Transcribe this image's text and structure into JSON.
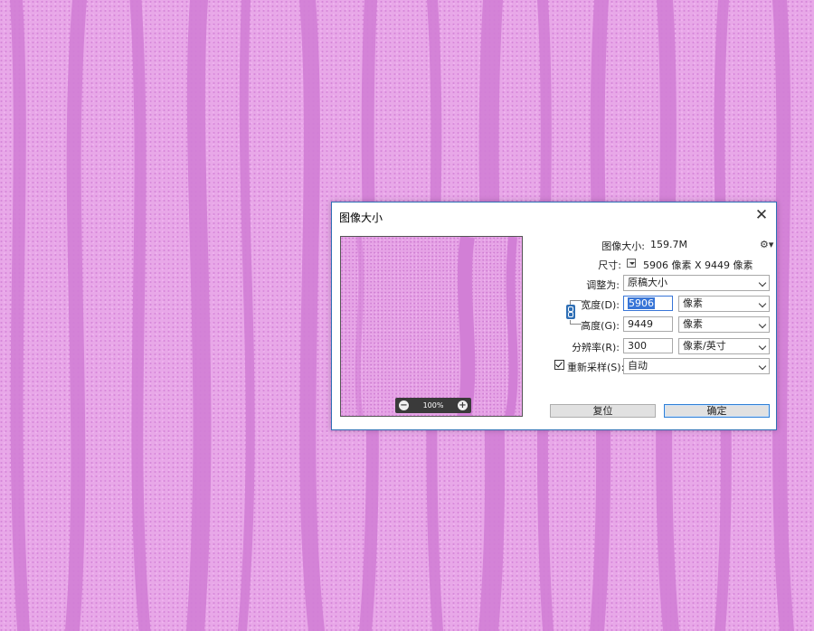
{
  "dialog": {
    "title": "图像大小",
    "close_glyph": "✕",
    "image_size_label": "图像大小:",
    "image_size_value": "159.7M",
    "dimensions_label": "尺寸:",
    "dimensions_value": "5906 像素  X  9449 像素",
    "fit_to_label": "调整为:",
    "fit_to_value": "原稿大小",
    "width_label": "宽度(D):",
    "width_value": "5906",
    "width_unit": "像素",
    "height_label": "高度(G):",
    "height_value": "9449",
    "height_unit": "像素",
    "resolution_label": "分辨率(R):",
    "resolution_value": "300",
    "resolution_unit": "像素/英寸",
    "resample_label": "重新采样(S):",
    "resample_checked": true,
    "resample_value": "自动",
    "reset_button": "复位",
    "ok_button": "确定",
    "gear_glyph": "⚙▾"
  },
  "preview": {
    "zoom_level": "100%",
    "zoom_out_glyph": "−",
    "zoom_in_glyph": "+"
  },
  "icons": {
    "gear": "gear-icon",
    "link": "link-icon",
    "close": "close-icon",
    "zoom_in": "zoom-in-icon",
    "zoom_out": "zoom-out-icon"
  },
  "colors": {
    "background_light": "#f0b4f0",
    "background_stripe": "#d27fd6",
    "dialog_border": "#2f6fb5",
    "selection": "#3875d7"
  }
}
